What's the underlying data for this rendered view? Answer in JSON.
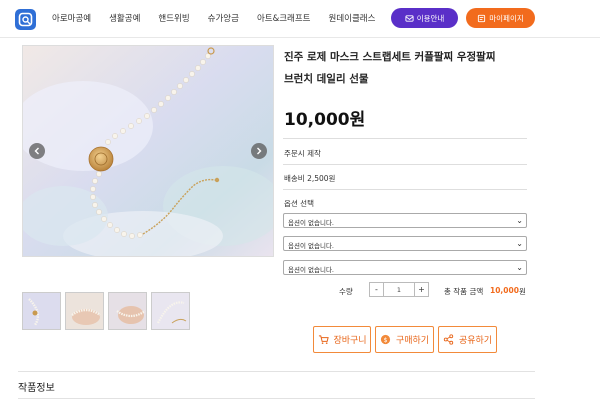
{
  "header": {
    "nav": [
      "아로마공예",
      "생활공예",
      "핸드위빙",
      "슈가앙금",
      "아트&크래프트",
      "원데이클래스"
    ],
    "guide_label": "이용안내",
    "mypage_label": "마이페이지"
  },
  "product": {
    "title_line1": "진주 로제 마스크 스트랩세트 커플팔찌 우정팔찌",
    "title_line2": "브런치 데일리 선물",
    "price": "10,000원",
    "made_to_order": "주문시 제작",
    "shipping": "배송비 2,500원",
    "option_label": "옵션 선택",
    "options": [
      "옵션이 없습니다.",
      "옵션이 없습니다.",
      "옵션이 없습니다."
    ],
    "qty_label": "수량",
    "qty_minus": "-",
    "qty_value": "1",
    "qty_plus": "+",
    "total_label": "총 작품 금액",
    "total_value": "10,000",
    "total_unit": "원"
  },
  "actions": {
    "cart": "장바구니",
    "buy": "구매하기",
    "share": "공유하기"
  },
  "section": {
    "title": "작품정보"
  },
  "colors": {
    "accent_orange": "#f26b1d",
    "accent_purple": "#5a2fc8",
    "logo_blue": "#2f6fd6"
  }
}
